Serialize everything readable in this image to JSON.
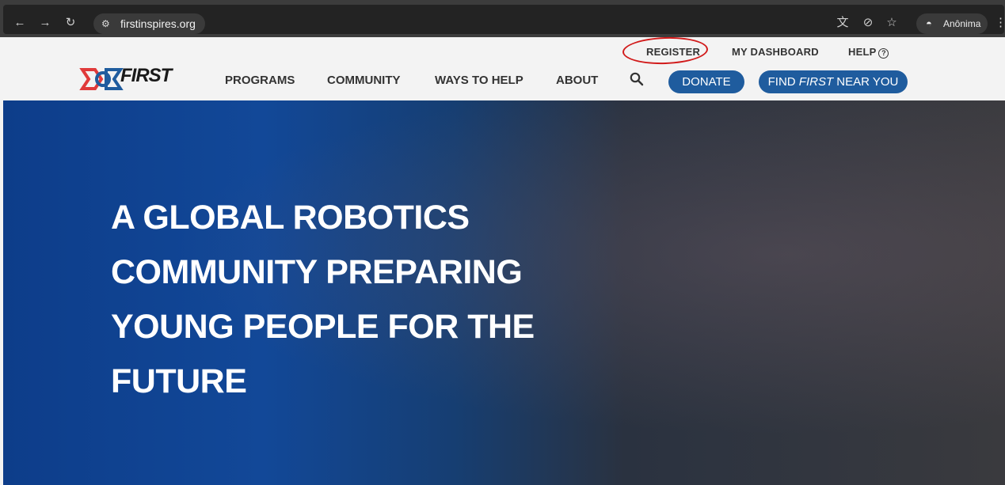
{
  "browser": {
    "url": "firstinspires.org",
    "profile_label": "Anônima"
  },
  "header": {
    "utility_links": {
      "register": "REGISTER",
      "dashboard": "MY DASHBOARD",
      "help": "HELP"
    },
    "logo_text": "FIRST",
    "nav": [
      "PROGRAMS",
      "COMMUNITY",
      "WAYS TO HELP",
      "ABOUT"
    ],
    "donate_label": "DONATE",
    "find_label_prefix": "FIND ",
    "find_label_em": "FIRST",
    "find_label_suffix": " NEAR YOU"
  },
  "hero": {
    "title_lines": [
      "A GLOBAL ROBOTICS",
      "COMMUNITY PREPARING",
      "YOUNG PEOPLE FOR THE",
      "FUTURE"
    ]
  },
  "colors": {
    "brand_blue": "#1f5c9e",
    "annotation_red": "#d11a1a",
    "hero_blue": "#124898"
  }
}
